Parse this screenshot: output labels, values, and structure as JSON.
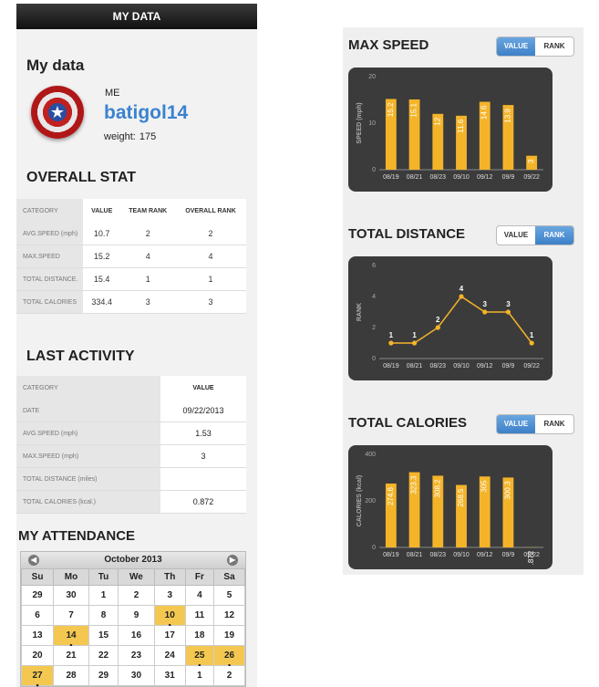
{
  "topbar": {
    "title": "MY DATA"
  },
  "profile": {
    "heading": "My data",
    "me_label": "ME",
    "username": "batigol14",
    "weight_label": "weight:",
    "weight_value": "175"
  },
  "overall": {
    "title": "OVERALL STAT",
    "headers": [
      "CATEGORY",
      "VALUE",
      "TEAM RANK",
      "OVERALL RANK"
    ],
    "rows": [
      {
        "category": "AVG.SPEED (mph)",
        "value": "10.7",
        "team_rank": "2",
        "overall_rank": "2"
      },
      {
        "category": "MAX.SPEED",
        "value": "15.2",
        "team_rank": "4",
        "overall_rank": "4"
      },
      {
        "category": "TOTAL DISTANCE.",
        "value": "15.4",
        "team_rank": "1",
        "overall_rank": "1"
      },
      {
        "category": "TOTAL CALORIES",
        "value": "334.4",
        "team_rank": "3",
        "overall_rank": "3"
      }
    ]
  },
  "last_activity": {
    "title": "LAST ACTIVITY",
    "headers": [
      "CATEGORY",
      "VALUE"
    ],
    "rows": [
      {
        "category": "DATE",
        "value": "09/22/2013"
      },
      {
        "category": "AVG.SPEED (mph)",
        "value": "1.53"
      },
      {
        "category": "MAX.SPEED (mph)",
        "value": "3"
      },
      {
        "category": "TOTAL DISTANCE (miles)",
        "value": ""
      },
      {
        "category": "TOTAL CALORIES (kcal.)",
        "value": "0.872"
      }
    ]
  },
  "attendance": {
    "title": "MY ATTENDANCE",
    "month": "October 2013",
    "prev_icon": "◀",
    "next_icon": "▶",
    "weekdays": [
      "Su",
      "Mo",
      "Tu",
      "We",
      "Th",
      "Fr",
      "Sa"
    ],
    "weeks": [
      [
        "29",
        "30",
        "1",
        "2",
        "3",
        "4",
        "5"
      ],
      [
        "6",
        "7",
        "8",
        "9",
        "10",
        "11",
        "12"
      ],
      [
        "13",
        "14",
        "15",
        "16",
        "17",
        "18",
        "19"
      ],
      [
        "20",
        "21",
        "22",
        "23",
        "24",
        "25",
        "26"
      ],
      [
        "27",
        "28",
        "29",
        "30",
        "31",
        "1",
        "2"
      ]
    ],
    "attended": [
      "10",
      "14",
      "25",
      "26",
      "27"
    ],
    "accent_color": "#f4c850"
  },
  "max_speed": {
    "title": "MAX SPEED",
    "toggle": {
      "value": "VALUE",
      "rank": "RANK",
      "active": "value"
    }
  },
  "total_distance": {
    "title": "TOTAL DISTANCE",
    "toggle": {
      "value": "VALUE",
      "rank": "RANK",
      "active": "rank"
    }
  },
  "total_calories": {
    "title": "TOTAL CALORIES",
    "toggle": {
      "value": "VALUE",
      "rank": "RANK",
      "active": "value"
    }
  },
  "chart_data": [
    {
      "type": "bar",
      "categories": [
        "08/19",
        "08/21",
        "08/23",
        "09/10",
        "09/12",
        "09/9",
        "09/22"
      ],
      "values": [
        15.2,
        15.1,
        12,
        11.6,
        14.6,
        13.9,
        3
      ],
      "labels": [
        "15.2",
        "15.1",
        "12",
        "11.6",
        "14.6",
        "13.9",
        "3"
      ],
      "ylabel": "SPEED (mph)",
      "ylim": [
        0,
        20
      ],
      "yticks": [
        "0",
        "10",
        "20"
      ],
      "color": "#f4b42a"
    },
    {
      "type": "line",
      "categories": [
        "08/19",
        "08/21",
        "08/23",
        "09/10",
        "09/12",
        "09/9",
        "09/22"
      ],
      "values": [
        1,
        1,
        2,
        4,
        3,
        3,
        1
      ],
      "labels": [
        "1",
        "1",
        "2",
        "4",
        "3",
        "3",
        "1"
      ],
      "ylabel": "RANK",
      "ylim": [
        0,
        6
      ],
      "yticks": [
        "0",
        "2",
        "4",
        "6"
      ],
      "color": "#f4b42a"
    },
    {
      "type": "bar",
      "categories": [
        "08/19",
        "08/21",
        "08/23",
        "09/10",
        "09/12",
        "09/9",
        "09/22"
      ],
      "values": [
        274.6,
        323.3,
        308.2,
        268.5,
        305,
        300.3,
        0.872
      ],
      "labels": [
        "274.6",
        "323.3",
        "308.2",
        "268.5",
        "305",
        "300.3",
        ".872"
      ],
      "ylabel": "CALORIES (kcal)",
      "ylim": [
        0,
        400
      ],
      "yticks": [
        "0",
        "200",
        "400"
      ],
      "color": "#f4b42a"
    }
  ]
}
